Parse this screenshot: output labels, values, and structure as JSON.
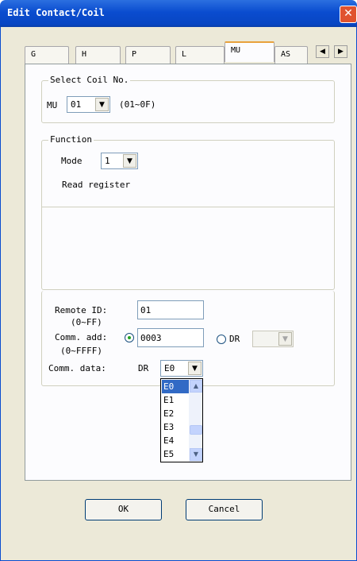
{
  "window": {
    "title": "Edit Contact/Coil"
  },
  "tabs": [
    {
      "label": "G"
    },
    {
      "label": "H"
    },
    {
      "label": "P"
    },
    {
      "label": "L"
    },
    {
      "label": "MU"
    },
    {
      "label": "AS"
    }
  ],
  "active_tab": "MU",
  "select_coil": {
    "legend": "Select Coil No.",
    "prefix": "MU",
    "value": "01",
    "range": "(01~0F)"
  },
  "function": {
    "legend": "Function",
    "mode_label": "Mode",
    "mode_value": "1",
    "description": "Read register"
  },
  "remote": {
    "remote_id_label": "Remote ID:",
    "remote_id_range": "(0~FF)",
    "remote_id_value": "01",
    "comm_add_label": "Comm. add:",
    "comm_add_range": "(0~FFFF)",
    "comm_add_value": "0003",
    "dr_radio_label": "DR",
    "comm_data_label": "Comm. data:",
    "comm_data_prefix": "DR",
    "comm_data_value": "E0",
    "dropdown_options": [
      "E0",
      "E1",
      "E2",
      "E3",
      "E4",
      "E5"
    ]
  },
  "buttons": {
    "ok": "OK",
    "cancel": "Cancel"
  }
}
